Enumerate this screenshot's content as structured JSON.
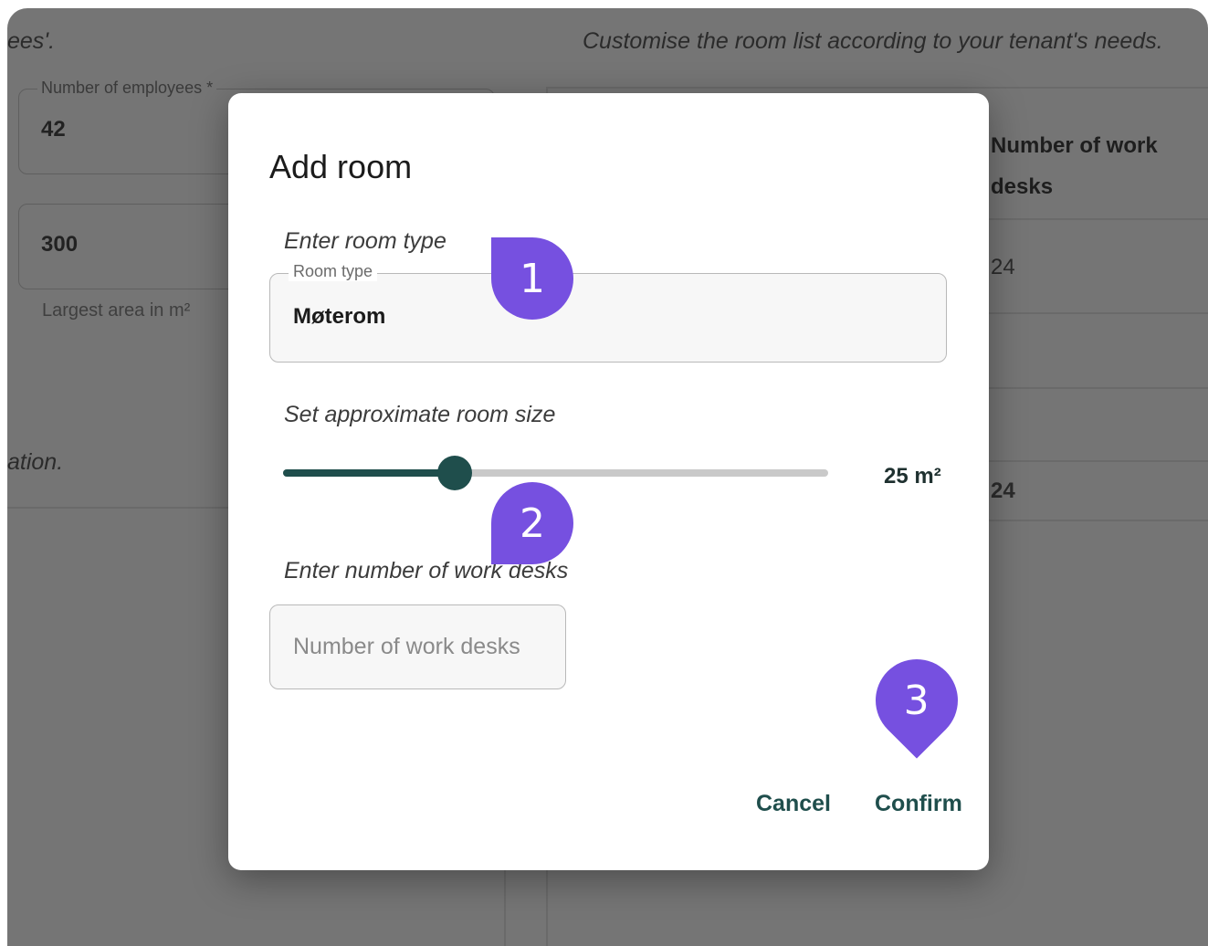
{
  "background": {
    "top_left_text": "ees'.",
    "top_right_text": "Customise the room list according to your tenant's needs.",
    "employees_field": {
      "label": "Number of employees *",
      "value": "42"
    },
    "area_field": {
      "value": "300",
      "helper": "Largest area in m²"
    },
    "left_italic_text": "ation.",
    "table": {
      "column_header": "Number of work desks",
      "rows": [
        "24",
        "",
        "",
        "24"
      ]
    }
  },
  "dialog": {
    "title": "Add room",
    "room_type_prompt": "Enter room type",
    "room_type_field": {
      "label": "Room type",
      "value": "Møterom"
    },
    "size_prompt": "Set approximate room size",
    "size_slider": {
      "value_label": "25 m²",
      "fraction": 0.315
    },
    "desks_prompt": "Enter number of work desks",
    "desks_field": {
      "placeholder": "Number of work desks",
      "value": ""
    },
    "cancel_label": "Cancel",
    "confirm_label": "Confirm"
  },
  "markers": [
    "1",
    "2",
    "3"
  ],
  "colors": {
    "accent": "#1f4e4c",
    "marker": "#7650e0",
    "overlay": "#757575"
  }
}
